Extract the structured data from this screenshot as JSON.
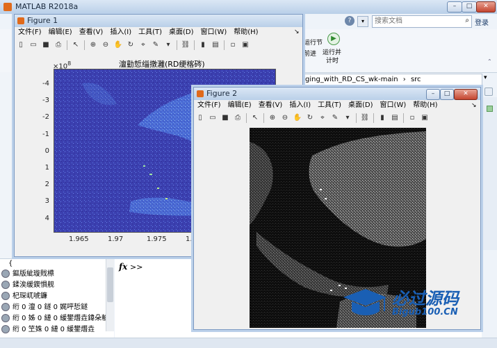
{
  "matlab": {
    "title": "MATLAB R2018a",
    "search_placeholder": "搜索文档",
    "login": "登录",
    "ribbon": {
      "run_section_1": "运行节",
      "run_advance": "前进",
      "run_time_line1": "运行并",
      "run_time_line2": "计时"
    },
    "address": {
      "path1": "ging_with_RD_CS_wk-main",
      "sep": "›",
      "path2": "src"
    },
    "command_prompt": ">>",
    "fx": "fx",
    "history_open": "{",
    "history_items": [
      "鏂版紪璇戝櫒",
      "鍒涘缓鍥惧舰",
      "杞琛屼唬鐮",
      "绗 0 澶 0 鐩 0 娓呯悊鐩",
      "绗 0 姊 0 縺 0 緩鐢熸垚鍏朵粬",
      "绗 0 笁姝 0 縺 0 緩鐢熸垚"
    ]
  },
  "fig1": {
    "title": "Figure 1",
    "menu": [
      "文件(F)",
      "编辑(E)",
      "查看(V)",
      "插入(I)",
      "工具(T)",
      "桌面(D)",
      "窗口(W)",
      "帮助(H)"
    ],
    "plot_title": "澶勭悊缁撴灉(RD绠楁硶)",
    "exponent": "×10",
    "exponent_power": "8",
    "y_ticks": [
      "-4",
      "-3",
      "-2",
      "-1",
      "0",
      "1",
      "2",
      "3",
      "4"
    ],
    "x_ticks": [
      "1.965",
      "1.97",
      "1.975",
      "1.98"
    ]
  },
  "fig2": {
    "title": "Figure 2",
    "menu": [
      "文件(F)",
      "编辑(E)",
      "查看(V)",
      "插入(I)",
      "工具(T)",
      "桌面(D)",
      "窗口(W)",
      "帮助(H)"
    ]
  },
  "watermark": {
    "main": "必过源码",
    "sub": "Bigub100.CN"
  },
  "colors": {
    "titlebar": "#c9dbef",
    "plot_bg": "#3a3fb0",
    "sar_bg": "#0b0b0b",
    "accent": "#1a5fb4"
  }
}
